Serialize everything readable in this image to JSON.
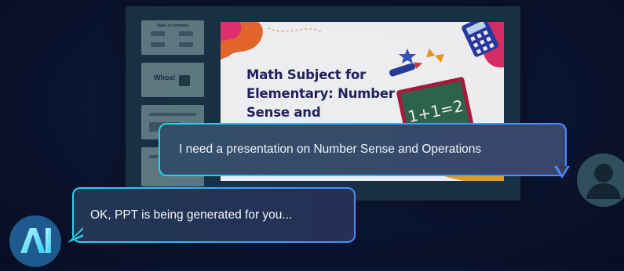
{
  "thumbnails": [
    {
      "title": "Table of contents"
    },
    {
      "title": "Whoa!"
    },
    {
      "title": ""
    },
    {
      "title": ""
    }
  ],
  "slide": {
    "title_line1": "Math Subject for",
    "title_line2": "Elementary: Number",
    "title_line3": "Sense and Operations",
    "chalkboard_text": "1+1=2"
  },
  "chat": {
    "user_message": "I need a presentation on Number Sense and Operations",
    "ai_message": "OK, PPT is being generated for you...",
    "ai_avatar_label": "AI"
  },
  "colors": {
    "background": "#0b1430",
    "bubble_border_start": "#2ad1e9",
    "bubble_border_end": "#4a89ff",
    "slide_title": "#26215e"
  }
}
